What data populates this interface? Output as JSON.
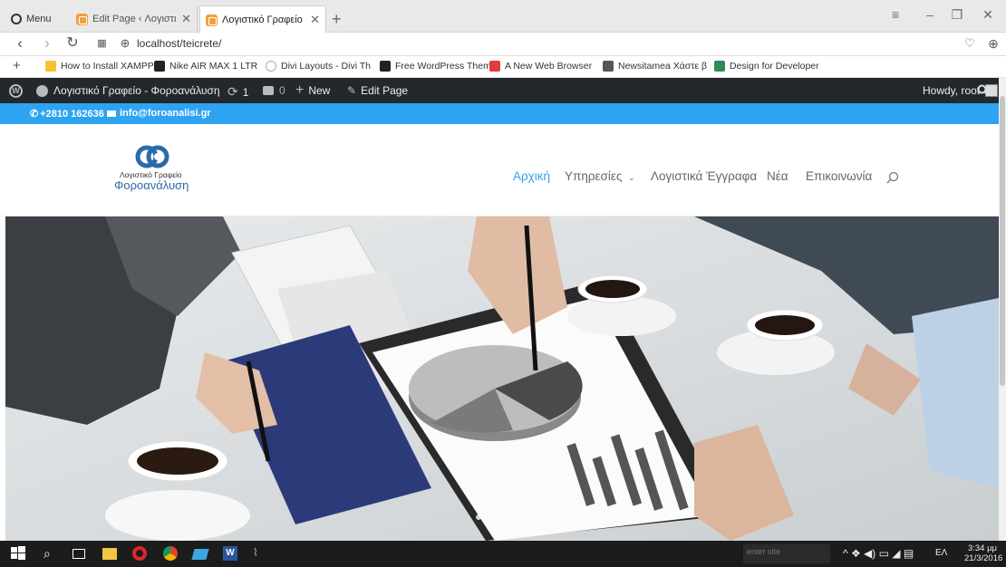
{
  "browser": {
    "tabs": [
      {
        "label": "Menu"
      },
      {
        "label": "Edit Page ‹ Λογιστικό Γρα"
      },
      {
        "label": "Λογιστικό Γραφείο – Φορ"
      }
    ],
    "url": "localhost/teicrete/"
  },
  "bookmarks": [
    {
      "label": "How to Install XAMPP",
      "color": "#f2c230"
    },
    {
      "label": "Nike AIR MAX 1 LTR",
      "color": "#222222"
    },
    {
      "label": "Divi Layouts - Divi Th",
      "color": "#bbbbbb"
    },
    {
      "label": "Free WordPress Them",
      "color": "#222222"
    },
    {
      "label": "A New Web Browser",
      "color": "#e33b3b"
    },
    {
      "label": "Newsitamea Χάστε β",
      "color": "#555555"
    },
    {
      "label": "Design for Developer",
      "color": "#2e8b57"
    }
  ],
  "adminbar": {
    "site": "Λογιστικό Γραφείο - Φοροανάλυση",
    "updates": "1",
    "comments": "0",
    "new": "New",
    "edit": "Edit Page",
    "howdy": "Howdy, root"
  },
  "topbar": {
    "phone": "+2810 162636",
    "email": "info@foroanalisi.gr"
  },
  "logo": {
    "line1": "Λογιστικό Γραφείο",
    "line2": "Φοροανάλυση"
  },
  "nav": [
    {
      "label": "Αρχική",
      "active": true
    },
    {
      "label": "Υπηρεσίες",
      "active": false
    },
    {
      "label": "Λογιστικά Έγγραφα",
      "active": false
    },
    {
      "label": "Νέα",
      "active": false
    },
    {
      "label": "Επικοινωνία",
      "active": false
    }
  ],
  "taskbar": {
    "search_placeholder": "enter site",
    "lang": "ΕΛ",
    "time": "3:34 μμ",
    "date": "21/3/2016"
  },
  "colors": {
    "accent": "#2ea3f2",
    "adminbar": "#23282d"
  }
}
